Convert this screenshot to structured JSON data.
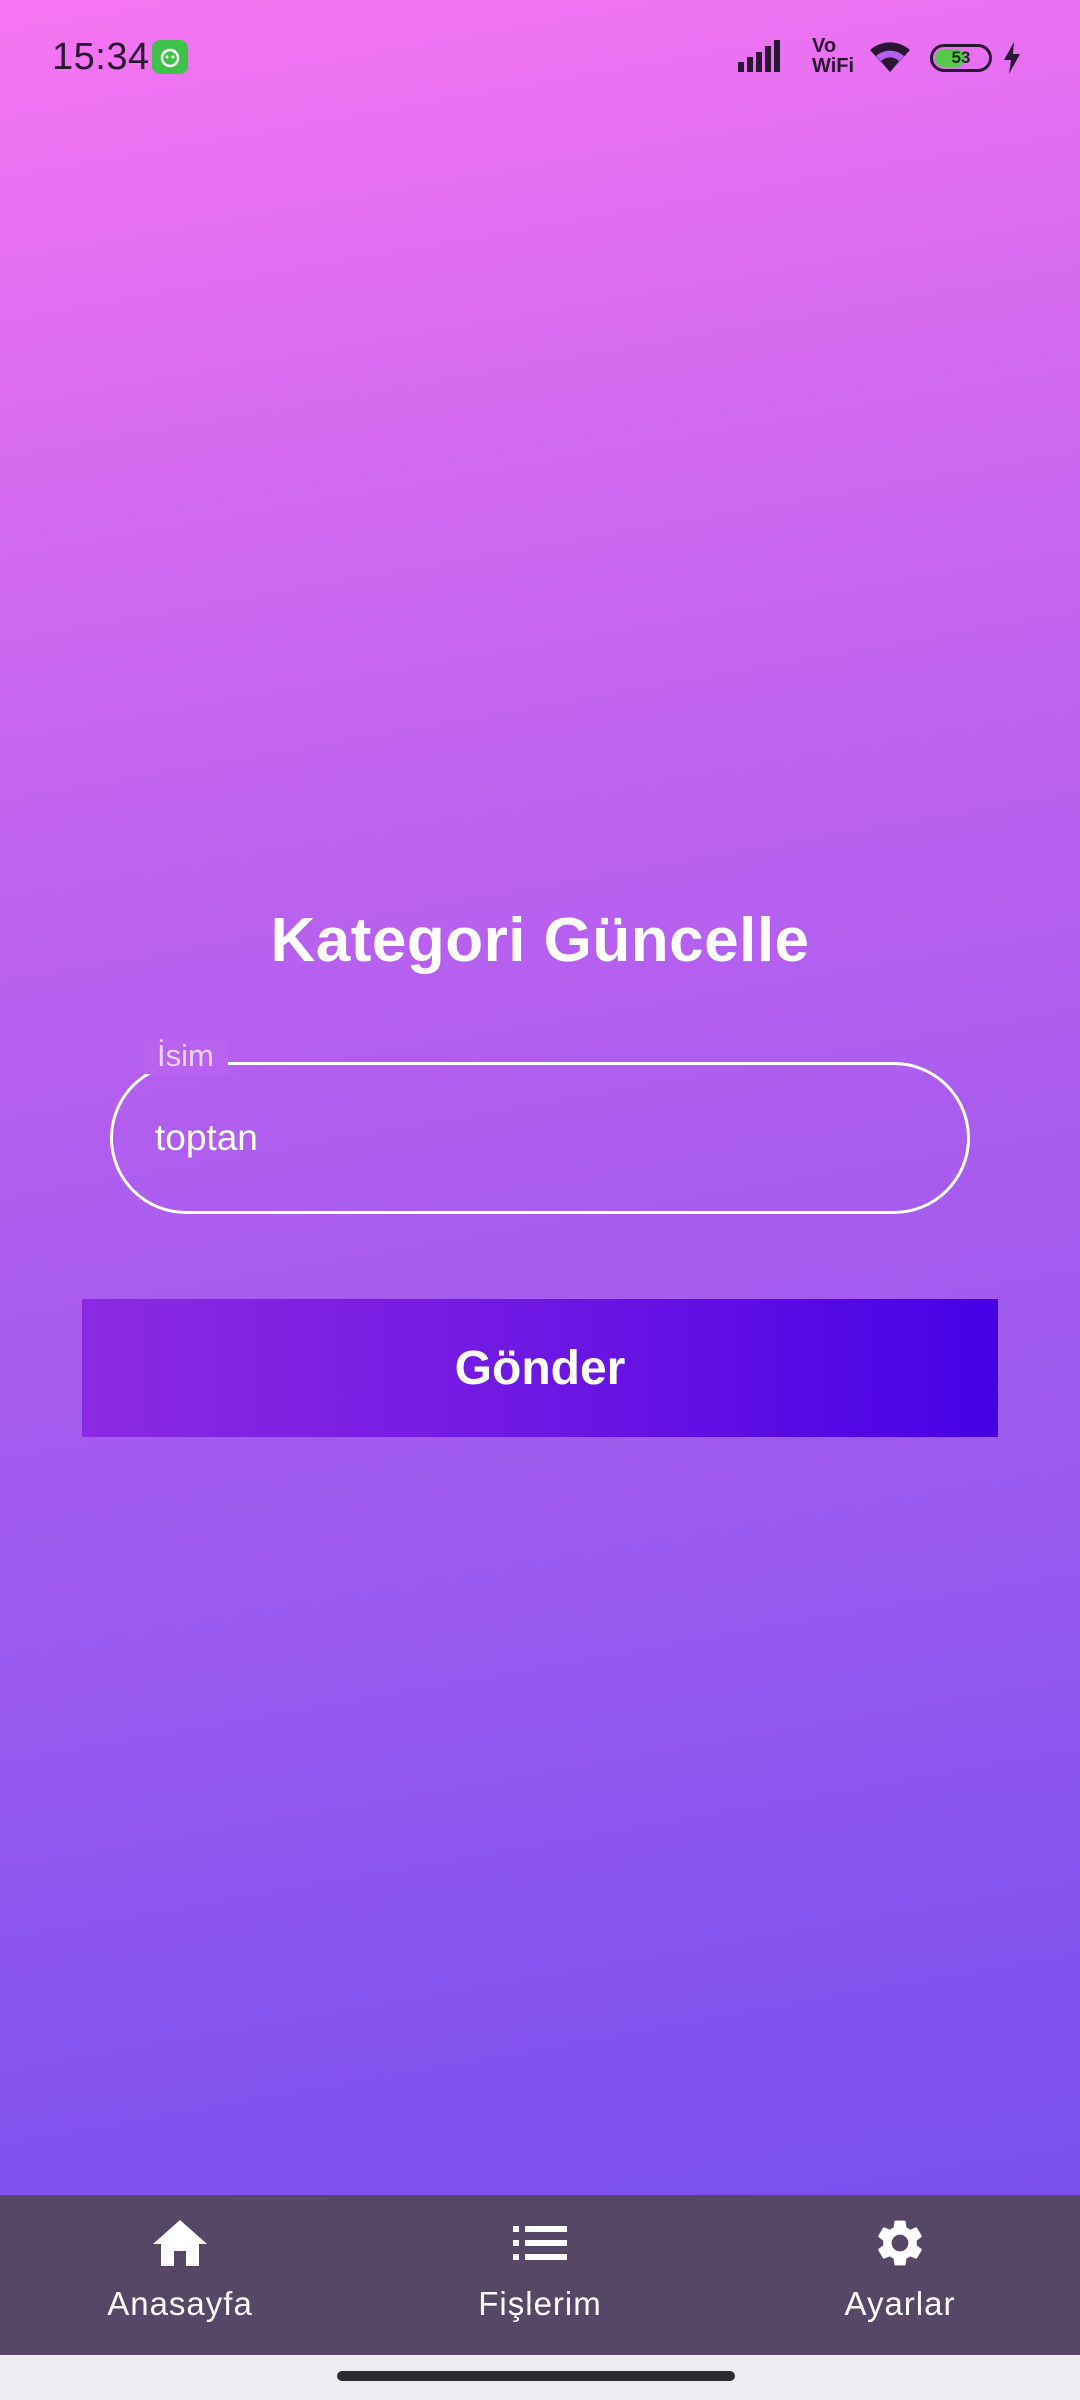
{
  "status_bar": {
    "time": "15:34",
    "network_label_top": "Vo",
    "network_label_bottom": "WiFi",
    "battery_level": "53",
    "battery_fraction": 0.53
  },
  "form": {
    "title": "Kategori Güncelle",
    "name_field": {
      "label": "İsim",
      "value": "toptan"
    },
    "submit_label": "Gönder"
  },
  "bottom_nav": {
    "items": [
      {
        "label": "Anasayfa",
        "icon": "home-icon"
      },
      {
        "label": "Fişlerim",
        "icon": "list-icon"
      },
      {
        "label": "Ayarlar",
        "icon": "gear-icon"
      }
    ]
  },
  "colors": {
    "gradient_top": "#f776f3",
    "gradient_bottom": "#7a50ee",
    "button_start": "#8b2ae2",
    "button_end": "#4600e6",
    "nav_background": "#564766"
  }
}
